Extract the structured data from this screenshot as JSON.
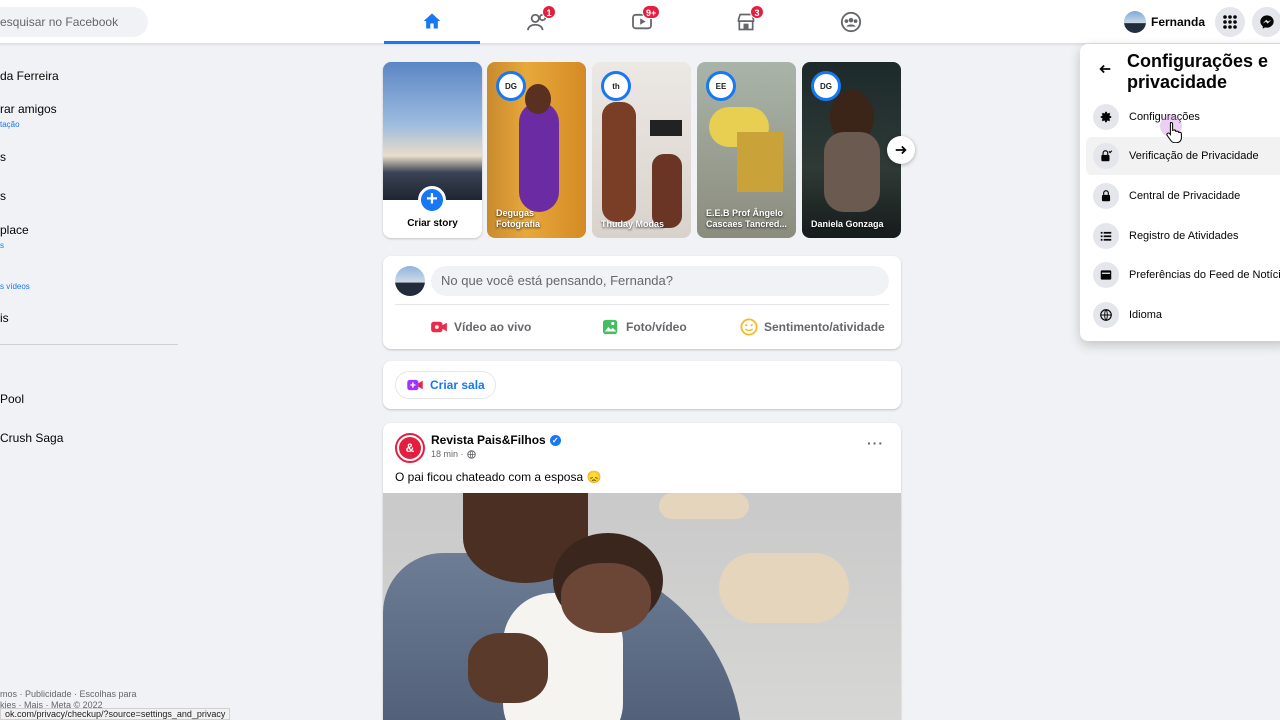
{
  "search": {
    "placeholder": "esquisar no Facebook"
  },
  "nav": {
    "tabs": [
      {
        "name": "home",
        "badge": ""
      },
      {
        "name": "friends",
        "badge": "1"
      },
      {
        "name": "watch",
        "badge": "9+"
      },
      {
        "name": "marketplace",
        "badge": "3"
      },
      {
        "name": "groups",
        "badge": ""
      }
    ],
    "profile_name": "Fernanda"
  },
  "left_sidebar": {
    "items": [
      {
        "label": "da Ferreira",
        "sub": ""
      },
      {
        "label": "rar amigos",
        "sub": "tação"
      },
      {
        "label": "s",
        "sub": ""
      },
      {
        "label": "s",
        "sub": ""
      },
      {
        "label": "place",
        "sub": "s"
      },
      {
        "label": "",
        "sub": "s vídeos"
      },
      {
        "label": "is",
        "sub": ""
      },
      {
        "label": "Pool",
        "sub": ""
      },
      {
        "label": "Crush Saga",
        "sub": ""
      }
    ],
    "footer_line1": "mos · Publicidade · Escolhas para",
    "footer_line2": "kies · Mais · Meta © 2022"
  },
  "status_url": "ok.com/privacy/checkup/?source=settings_and_privacy",
  "stories": {
    "create_label": "Criar story",
    "items": [
      {
        "name": "Degugas Fotografia",
        "ring_text": "DG"
      },
      {
        "name": "Thuday Modas",
        "ring_text": "th"
      },
      {
        "name": "E.E.B Prof Ângelo Cascaes Tancred...",
        "ring_text": "EE"
      },
      {
        "name": "Daniela Gonzaga",
        "ring_text": "DG"
      }
    ]
  },
  "composer": {
    "placeholder": "No que você está pensando, Fernanda?",
    "actions": [
      "Vídeo ao vivo",
      "Foto/vídeo",
      "Sentimento/atividade"
    ]
  },
  "room": {
    "label": "Criar sala"
  },
  "post": {
    "author": "Revista Pais&Filhos",
    "time": "18 min ·",
    "text": "O pai ficou chateado com a esposa 😞",
    "avatar_text": "&"
  },
  "dropdown": {
    "title": "Configurações e privacidade",
    "items": [
      {
        "label": "Configurações",
        "icon": "gear-icon"
      },
      {
        "label": "Verificação de Privacidade",
        "icon": "lock-check-icon"
      },
      {
        "label": "Central de Privacidade",
        "icon": "lock-icon"
      },
      {
        "label": "Registro de Atividades",
        "icon": "list-icon"
      },
      {
        "label": "Preferências do Feed de Notícias",
        "icon": "feed-icon"
      },
      {
        "label": "Idioma",
        "icon": "globe-icon"
      }
    ]
  },
  "colors": {
    "accent": "#1877f2",
    "badge": "#e41e3f",
    "background": "#f0f2f5"
  }
}
